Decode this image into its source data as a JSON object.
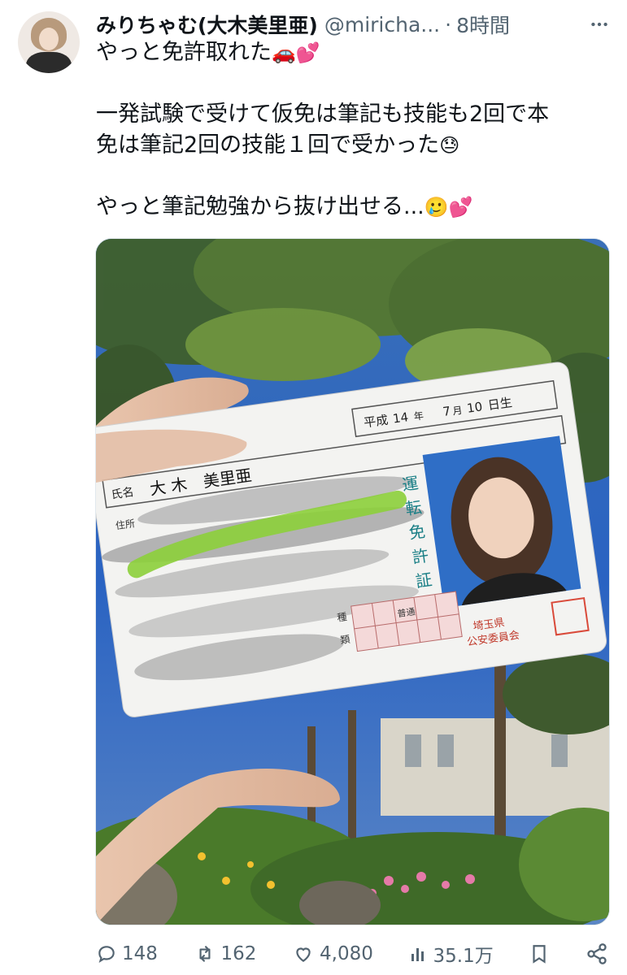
{
  "user": {
    "display_name": "みりちゃむ(大木美里亜)",
    "handle": "@miricha...",
    "separator": "·",
    "time": "8時間"
  },
  "tweet": {
    "line1": "やっと免許取れた",
    "line1_emoji": "🚗💕",
    "line2": "一発試験で受けて仮免は筆記も技能も2回で本",
    "line3": "免は筆記2回の技能１回で受かった",
    "line3_emoji": "😓",
    "line4": "やっと筆記勉強から抜け出せる...",
    "line4_emoji": "🥲💕"
  },
  "license": {
    "birth_era": "平成",
    "birth_year": "14",
    "birth_month": "7",
    "birth_day": "10",
    "birth_suffix": "日生",
    "name_label": "氏名",
    "name": "大 木　美里亜",
    "address_label": "住所",
    "type_label": "運転免許証",
    "class_label_1": "種",
    "class_label_2": "類",
    "class_common": "普通",
    "issuer_pref": "埼玉県",
    "issuer_commission": "公安委員会",
    "stamp_text": "埼玉県公安委員会印"
  },
  "actions": {
    "replies": "148",
    "reposts": "162",
    "likes": "4,080",
    "views": "35.1万"
  },
  "colors": {
    "text_primary": "#0f1419",
    "text_secondary": "#536471",
    "sky": "#2f6bc4",
    "card": "#f3f3f1",
    "highlight_green": "#8ccf3a",
    "stamp_red": "#d94a3a",
    "teal_text": "#1a7f86"
  },
  "icons": [
    "more-icon",
    "reply-icon",
    "repost-icon",
    "like-icon",
    "views-icon",
    "bookmark-icon",
    "share-icon"
  ]
}
